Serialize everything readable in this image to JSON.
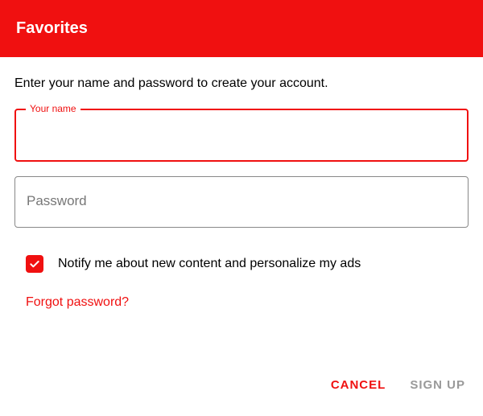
{
  "header": {
    "title": "Favorites"
  },
  "form": {
    "instruction": "Enter your name and password to create your account.",
    "name_field": {
      "label": "Your name",
      "value": ""
    },
    "password_field": {
      "placeholder": "Password",
      "value": ""
    },
    "notify_checkbox": {
      "checked": true,
      "label": "Notify me about new content and personalize my ads"
    },
    "forgot_link": "Forgot password?"
  },
  "actions": {
    "cancel": "CANCEL",
    "signup": "SIGN UP"
  },
  "colors": {
    "accent": "#f01010"
  }
}
